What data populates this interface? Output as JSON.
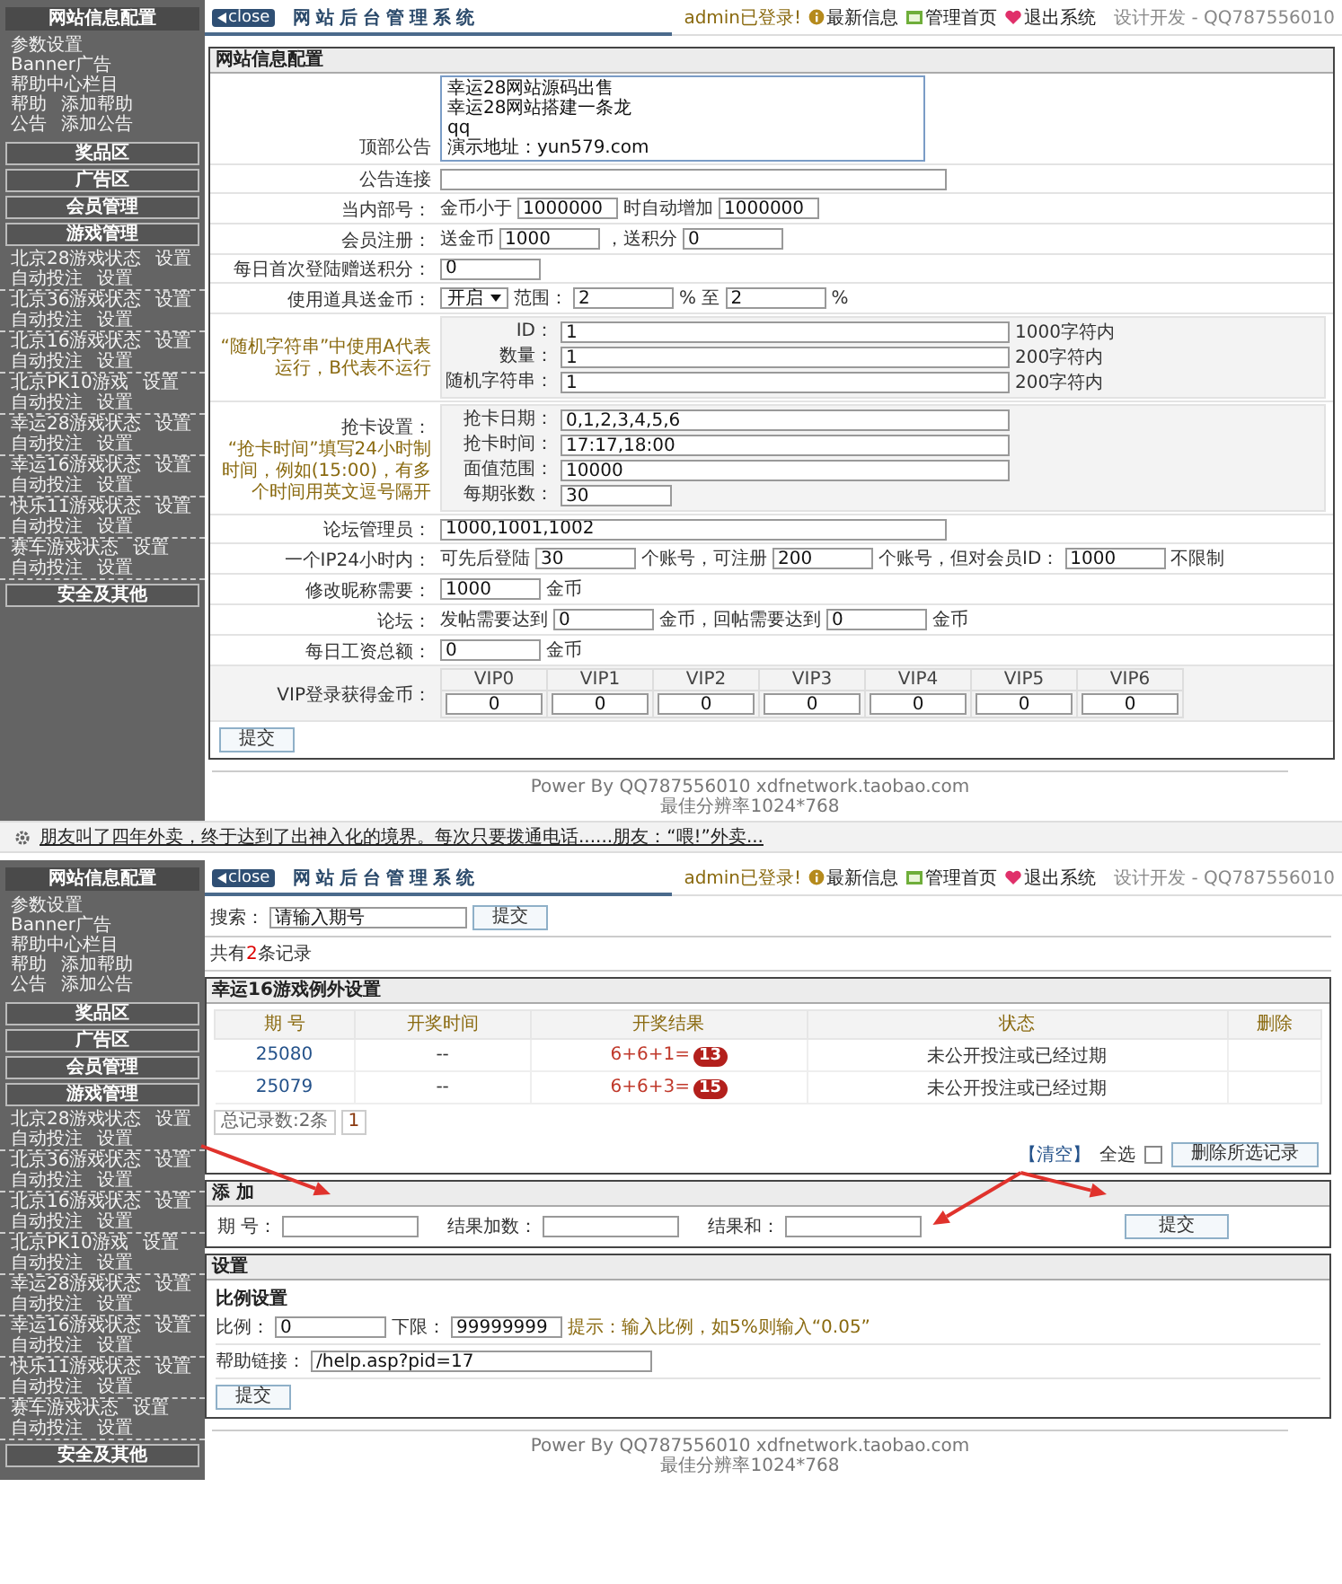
{
  "config_screen": {
    "header": {
      "close": "close",
      "title": "网站后台管理系统",
      "user": "admin已登录!",
      "links": [
        "最新信息",
        "管理首页",
        "退出系统"
      ],
      "credit": "设计开发 - QQ787556010"
    },
    "sidebar": [
      {
        "title": "网站信息配置",
        "items": [
          {
            "links": [
              "参数设置"
            ]
          },
          {
            "links": [
              "Banner广告"
            ]
          },
          {
            "links": [
              "帮助中心栏目"
            ]
          },
          {
            "links": [
              "帮助",
              "添加帮助"
            ]
          },
          {
            "links": [
              "公告",
              "添加公告"
            ]
          }
        ]
      },
      {
        "title": "奖品区"
      },
      {
        "title": "广告区"
      },
      {
        "title": "会员管理"
      },
      {
        "title": "游戏管理",
        "groups": [
          {
            "items": [
              {
                "links": [
                  "北京28游戏状态",
                  "设置"
                ]
              },
              {
                "links": [
                  "自动投注",
                  "设置"
                ]
              }
            ]
          },
          {
            "items": [
              {
                "links": [
                  "北京36游戏状态",
                  "设置"
                ]
              },
              {
                "links": [
                  "自动投注",
                  "设置"
                ]
              }
            ]
          },
          {
            "items": [
              {
                "links": [
                  "北京16游戏状态",
                  "设置"
                ]
              },
              {
                "links": [
                  "自动投注",
                  "设置"
                ]
              }
            ]
          },
          {
            "items": [
              {
                "links": [
                  "北京PK10游戏",
                  "设置"
                ]
              },
              {
                "links": [
                  "自动投注",
                  "设置"
                ]
              }
            ]
          },
          {
            "items": [
              {
                "links": [
                  "幸运28游戏状态",
                  "设置"
                ]
              },
              {
                "links": [
                  "自动投注",
                  "设置"
                ]
              }
            ]
          },
          {
            "items": [
              {
                "links": [
                  "幸运16游戏状态",
                  "设置"
                ]
              },
              {
                "links": [
                  "自动投注",
                  "设置"
                ]
              }
            ]
          },
          {
            "items": [
              {
                "links": [
                  "快乐11游戏状态",
                  "设置"
                ]
              },
              {
                "links": [
                  "自动投注",
                  "设置"
                ]
              }
            ]
          },
          {
            "items": [
              {
                "links": [
                  "赛车游戏状态",
                  "设置"
                ]
              },
              {
                "links": [
                  "自动投注",
                  "设置"
                ]
              }
            ]
          }
        ]
      },
      {
        "title": "安全及其他"
      }
    ],
    "panel_title": "网站信息配置",
    "rows": [
      {
        "kind": "textarea",
        "label": "顶部公告",
        "lines": [
          "幸运28网站源码出售",
          "幸运28网站搭建一条龙",
          "qq",
          "演示地址：yun579.com"
        ]
      },
      {
        "kind": "fields",
        "label": "公告连接",
        "parts": [
          {
            "kind": "xl_input"
          }
        ]
      },
      {
        "kind": "fields",
        "label": "当内部号：",
        "parts": [
          {
            "kind": "text",
            "text": "金币小于"
          },
          {
            "kind": "input",
            "value": "1000000"
          },
          {
            "kind": "text",
            "text": "时自动增加"
          },
          {
            "kind": "input",
            "value": "1000000"
          }
        ]
      },
      {
        "kind": "fields",
        "label": "会员注册：",
        "parts": [
          {
            "kind": "text",
            "text": "送金币"
          },
          {
            "kind": "input",
            "value": "1000"
          },
          {
            "kind": "text",
            "text": "，送积分"
          },
          {
            "kind": "input",
            "value": "0"
          }
        ]
      },
      {
        "kind": "fields",
        "label": "每日首次登陆赠送积分：",
        "parts": [
          {
            "kind": "input",
            "value": "0"
          }
        ]
      },
      {
        "kind": "fields",
        "label": "使用道具送金币：",
        "parts": [
          {
            "kind": "select",
            "value": "开启"
          },
          {
            "kind": "text",
            "text": "范围："
          },
          {
            "kind": "input",
            "value": "2"
          },
          {
            "kind": "text",
            "text": "% 至"
          },
          {
            "kind": "input",
            "value": "2"
          },
          {
            "kind": "text",
            "text": "%"
          }
        ]
      },
      {
        "kind": "group",
        "note": "“随机字符串”中使用A代表运行，B代表不运行",
        "rows": [
          {
            "label": "ID：",
            "parts": [
              {
                "kind": "long_input",
                "value": "1"
              },
              {
                "kind": "text",
                "text": "1000字符内"
              }
            ]
          },
          {
            "label": "数量：",
            "parts": [
              {
                "kind": "long_input",
                "value": "1"
              },
              {
                "kind": "text",
                "text": "200字符内"
              }
            ]
          },
          {
            "label": "随机字符串：",
            "parts": [
              {
                "kind": "long_input",
                "value": "1"
              },
              {
                "kind": "text",
                "text": "200字符内"
              }
            ]
          }
        ]
      },
      {
        "kind": "group",
        "label": "抢卡设置：",
        "note": "“抢卡时间”填写24小时制时间，例如(15:00)，有多个时间用英文逗号隔开",
        "rows": [
          {
            "label": "抢卡日期：",
            "parts": [
              {
                "kind": "long_input",
                "value": "0,1,2,3,4,5,6"
              }
            ]
          },
          {
            "label": "抢卡时间：",
            "parts": [
              {
                "kind": "long_input",
                "value": "17:17,18:00"
              }
            ]
          },
          {
            "label": "面值范围：",
            "parts": [
              {
                "kind": "long_input",
                "value": "10000"
              }
            ]
          },
          {
            "label": "每期张数：",
            "parts": [
              {
                "kind": "mid_input",
                "value": "30"
              }
            ]
          }
        ]
      },
      {
        "kind": "fields",
        "label": "论坛管理员：",
        "parts": [
          {
            "kind": "xl_input",
            "value": "1000,1001,1002"
          }
        ]
      },
      {
        "kind": "fields",
        "label": "一个IP24小时内：",
        "parts": [
          {
            "kind": "text",
            "text": "可先后登陆"
          },
          {
            "kind": "input",
            "value": "30"
          },
          {
            "kind": "text",
            "text": "个账号，可注册"
          },
          {
            "kind": "input",
            "value": "200"
          },
          {
            "kind": "text",
            "text": "个账号，但对会员ID："
          },
          {
            "kind": "input",
            "value": "1000"
          },
          {
            "kind": "text",
            "text": "不限制"
          }
        ]
      },
      {
        "kind": "fields",
        "label": "修改昵称需要：",
        "parts": [
          {
            "kind": "input",
            "value": "1000"
          },
          {
            "kind": "text",
            "text": "金币"
          }
        ]
      },
      {
        "kind": "fields",
        "label": "论坛：",
        "parts": [
          {
            "kind": "text",
            "text": "发帖需要达到"
          },
          {
            "kind": "input",
            "value": "0"
          },
          {
            "kind": "text",
            "text": "金币，回帖需要达到"
          },
          {
            "kind": "input",
            "value": "0"
          },
          {
            "kind": "text",
            "text": "金币"
          }
        ]
      },
      {
        "kind": "fields",
        "label": "每日工资总额：",
        "parts": [
          {
            "kind": "input",
            "value": "0"
          },
          {
            "kind": "text",
            "text": "金币"
          }
        ]
      },
      {
        "kind": "vip",
        "label": "VIP登录获得金币：",
        "levels": [
          {
            "name": "VIP0",
            "value": "0"
          },
          {
            "name": "VIP1",
            "value": "0"
          },
          {
            "name": "VIP2",
            "value": "0"
          },
          {
            "name": "VIP3",
            "value": "0"
          },
          {
            "name": "VIP4",
            "value": "0"
          },
          {
            "name": "VIP5",
            "value": "0"
          },
          {
            "name": "VIP6",
            "value": "0"
          }
        ]
      }
    ],
    "submit_button": "提交",
    "footer": [
      "Power By QQ787556010 xdfnetwork.taobao.com",
      "最佳分辨率1024*768"
    ]
  },
  "ticker": {
    "text": "朋友叫了四年外卖，终于达到了出神入化的境界。每次只要拨通电话......朋友：“喂!”外卖..."
  },
  "records_screen": {
    "header": {
      "close": "close",
      "title": "网站后台管理系统",
      "user": "admin已登录!",
      "links": [
        "最新信息",
        "管理首页",
        "退出系统"
      ],
      "credit": "设计开发 - QQ787556010"
    },
    "sidebar": [
      {
        "title": "网站信息配置",
        "items": [
          {
            "links": [
              "参数设置"
            ]
          },
          {
            "links": [
              "Banner广告"
            ]
          },
          {
            "links": [
              "帮助中心栏目"
            ]
          },
          {
            "links": [
              "帮助",
              "添加帮助"
            ]
          },
          {
            "links": [
              "公告",
              "添加公告"
            ]
          }
        ]
      },
      {
        "title": "奖品区"
      },
      {
        "title": "广告区"
      },
      {
        "title": "会员管理"
      },
      {
        "title": "游戏管理",
        "groups": [
          {
            "items": [
              {
                "links": [
                  "北京28游戏状态",
                  "设置"
                ]
              },
              {
                "links": [
                  "自动投注",
                  "设置"
                ]
              }
            ]
          },
          {
            "items": [
              {
                "links": [
                  "北京36游戏状态",
                  "设置"
                ]
              },
              {
                "links": [
                  "自动投注",
                  "设置"
                ]
              }
            ]
          },
          {
            "items": [
              {
                "links": [
                  "北京16游戏状态",
                  "设置"
                ]
              },
              {
                "links": [
                  "自动投注",
                  "设置"
                ]
              }
            ]
          },
          {
            "items": [
              {
                "links": [
                  "北京PK10游戏",
                  "设置"
                ]
              },
              {
                "links": [
                  "自动投注",
                  "设置"
                ]
              }
            ]
          },
          {
            "items": [
              {
                "links": [
                  "幸运28游戏状态",
                  "设置"
                ]
              },
              {
                "links": [
                  "自动投注",
                  "设置"
                ]
              }
            ]
          },
          {
            "items": [
              {
                "links": [
                  "幸运16游戏状态",
                  "设置"
                ]
              },
              {
                "links": [
                  "自动投注",
                  "设置"
                ]
              }
            ]
          },
          {
            "items": [
              {
                "links": [
                  "快乐11游戏状态",
                  "设置"
                ]
              },
              {
                "links": [
                  "自动投注",
                  "设置"
                ]
              }
            ]
          },
          {
            "items": [
              {
                "links": [
                  "赛车游戏状态",
                  "设置"
                ]
              },
              {
                "links": [
                  "自动投注",
                  "设置"
                ]
              }
            ]
          }
        ]
      },
      {
        "title": "安全及其他"
      }
    ],
    "search": {
      "label": "搜索：",
      "value": "请输入期号",
      "button": "提交"
    },
    "record_count": {
      "prefix": "共有",
      "count": "2",
      "suffix": "条记录"
    },
    "results": {
      "title": "幸运16游戏例外设置",
      "columns": [
        "期 号",
        "开奖时间",
        "开奖结果",
        "状态",
        "删除"
      ],
      "rows": [
        {
          "issue": "25080",
          "time": "--",
          "formula": "6+6+1=",
          "sum": "13",
          "status": "未公开投注或已经过期"
        },
        {
          "issue": "25079",
          "time": "--",
          "formula": "6+6+3=",
          "sum": "15",
          "status": "未公开投注或已经过期"
        }
      ],
      "pager": {
        "total": "总记录数:2条",
        "pages": [
          "1"
        ]
      },
      "clear": "【清空】",
      "select_all": {
        "label": "全选",
        "checked": false
      },
      "delete_button": "删除所选记录"
    },
    "add": {
      "title": "添 加",
      "fields": [
        {
          "label": "期 号："
        },
        {
          "label": "结果加数："
        },
        {
          "label": "结果和："
        }
      ],
      "button": "提交"
    },
    "settings": {
      "title": "设置",
      "subtitle": "比例设置",
      "ratio": {
        "label": "比例：",
        "value": "0"
      },
      "lower_limit": {
        "label": "下限：",
        "value": "99999999"
      },
      "hint": "提示：输入比例，如5%则输入“0.05”",
      "help_link": {
        "label": "帮助链接：",
        "value": "/help.asp?pid=17"
      },
      "button": "提交"
    },
    "footer": [
      "Power By QQ787556010 xdfnetwork.taobao.com",
      "最佳分辨率1024*768"
    ]
  }
}
